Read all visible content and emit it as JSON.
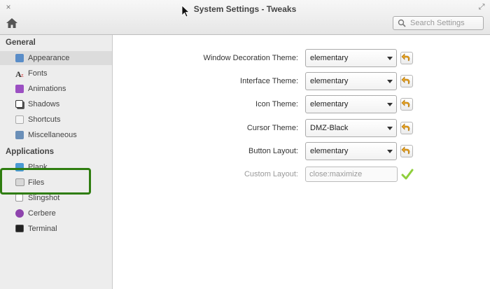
{
  "window": {
    "title": "System Settings - Tweaks",
    "close_glyph": "×",
    "max_glyph": "⤢"
  },
  "search": {
    "placeholder": "Search Settings"
  },
  "sidebar": {
    "general_heading": "General",
    "general_items": [
      {
        "label": "Appearance",
        "icon": "appearance-icon",
        "selected": true
      },
      {
        "label": "Fonts",
        "icon": "fonts-icon"
      },
      {
        "label": "Animations",
        "icon": "animations-icon"
      },
      {
        "label": "Shadows",
        "icon": "shadows-icon"
      },
      {
        "label": "Shortcuts",
        "icon": "shortcuts-icon"
      },
      {
        "label": "Miscellaneous",
        "icon": "miscellaneous-icon"
      }
    ],
    "applications_heading": "Applications",
    "app_items": [
      {
        "label": "Plank",
        "icon": "plank-icon"
      },
      {
        "label": "Files",
        "icon": "files-icon"
      },
      {
        "label": "Slingshot",
        "icon": "slingshot-icon"
      },
      {
        "label": "Cerbere",
        "icon": "cerbere-icon"
      },
      {
        "label": "Terminal",
        "icon": "terminal-icon"
      }
    ]
  },
  "settings": [
    {
      "label": "Window Decoration Theme:",
      "value": "elementary"
    },
    {
      "label": "Interface Theme:",
      "value": "elementary"
    },
    {
      "label": "Icon Theme:",
      "value": "elementary"
    },
    {
      "label": "Cursor Theme:",
      "value": "DMZ-Black"
    },
    {
      "label": "Button Layout:",
      "value": "elementary"
    }
  ],
  "custom_layout": {
    "label": "Custom Layout:",
    "value": "close:maximize"
  },
  "colors": {
    "highlight": "#2f7d10",
    "check": "#8fcf3c",
    "revert": "#e8a424"
  }
}
